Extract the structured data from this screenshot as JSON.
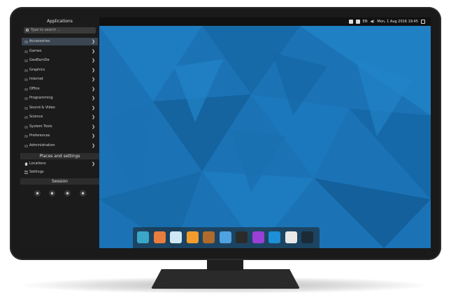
{
  "topbar": {
    "kbd": "EN",
    "clock": "Mon, 1 Aug 2016 19:45",
    "icons": [
      "window-icon",
      "screen-icon",
      "keyboard-icon",
      "volume-icon",
      "panel-icon"
    ]
  },
  "menu": {
    "title": "Applications",
    "search_placeholder": "Type to search ...",
    "categories": [
      {
        "label": "Accessories",
        "active": true
      },
      {
        "label": "Games"
      },
      {
        "label": "GeoBarnDe"
      },
      {
        "label": "Graphics"
      },
      {
        "label": "Internet"
      },
      {
        "label": "Office"
      },
      {
        "label": "Programming"
      },
      {
        "label": "Sound & Video"
      },
      {
        "label": "Science"
      },
      {
        "label": "System Tools"
      },
      {
        "label": "Preferences"
      },
      {
        "label": "Administration"
      }
    ],
    "places_title": "Places and settings",
    "places": [
      {
        "label": "Locations",
        "icon": "home-icon"
      },
      {
        "label": "Settings",
        "icon": "settings-icon"
      }
    ],
    "session_title": "Session",
    "session_buttons": [
      "lock-icon",
      "logout-icon",
      "restart-icon",
      "power-icon"
    ]
  },
  "dock": {
    "apps": [
      {
        "name": "files-app",
        "color": "#3aa7c9"
      },
      {
        "name": "software-app",
        "color": "#e87d3e"
      },
      {
        "name": "folder-app",
        "color": "#cfe8f5"
      },
      {
        "name": "firefox-app",
        "color": "#f39c2c"
      },
      {
        "name": "inkscape-app",
        "color": "#b06a2c"
      },
      {
        "name": "photos-app",
        "color": "#4fa3e0"
      },
      {
        "name": "terminal-app",
        "color": "#2b2b2b"
      },
      {
        "name": "chat-app",
        "color": "#9b3fd6"
      },
      {
        "name": "browser-app",
        "color": "#1c8fd6"
      },
      {
        "name": "calc-app",
        "color": "#e8e8e8"
      },
      {
        "name": "monitor-app",
        "color": "#1b2a36"
      }
    ]
  },
  "colors": {
    "wallpaper": "#1a74b8",
    "menu_bg": "#1b1b1b",
    "active_item": "#3b4652"
  }
}
